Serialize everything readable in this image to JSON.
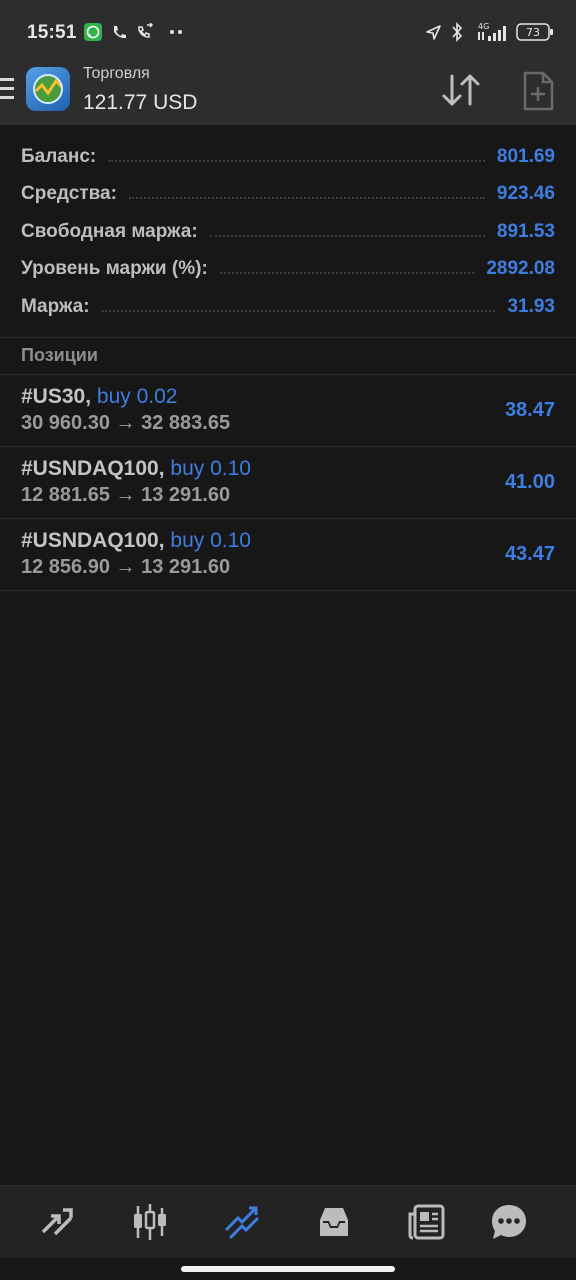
{
  "status_bar": {
    "time": "15:51",
    "battery": "73",
    "network": "4G",
    "icons": [
      "whatsapp-icon",
      "phone-icon",
      "call-forward-icon",
      "more-dots-icon",
      "location-arrow-icon",
      "bluetooth-icon",
      "signal-icon",
      "battery-icon"
    ]
  },
  "header": {
    "title": "Торговля",
    "balance": "121.77 USD",
    "icons": [
      "menu-icon",
      "metatrader-logo",
      "sort-icon",
      "new-order-icon"
    ]
  },
  "summary": [
    {
      "label": "Баланс:",
      "value": "801.69"
    },
    {
      "label": "Средства:",
      "value": "923.46"
    },
    {
      "label": "Свободная маржа:",
      "value": "891.53"
    },
    {
      "label": "Уровень маржи (%):",
      "value": "2892.08"
    },
    {
      "label": "Маржа:",
      "value": "31.93"
    }
  ],
  "positions_title": "Позиции",
  "positions": [
    {
      "symbol": "#US30,",
      "side": "buy 0.02",
      "prices": "30 960.30 → 32 883.65",
      "profit": "38.47"
    },
    {
      "symbol": "#USNDAQ100,",
      "side": "buy 0.10",
      "prices": "12 881.65 → 13 291.60",
      "profit": "41.00"
    },
    {
      "symbol": "#USNDAQ100,",
      "side": "buy 0.10",
      "prices": "12 856.90 → 13 291.60",
      "profit": "43.47"
    }
  ],
  "bottom_nav": {
    "items": [
      "quotes-icon",
      "chart-icon",
      "trade-icon",
      "history-icon",
      "news-icon",
      "chat-icon"
    ],
    "active": "trade-icon",
    "accent": "#3d7ee0"
  },
  "colors": {
    "background": "#171717",
    "header": "#2d2d2d",
    "value_blue": "#3d7ee0"
  }
}
